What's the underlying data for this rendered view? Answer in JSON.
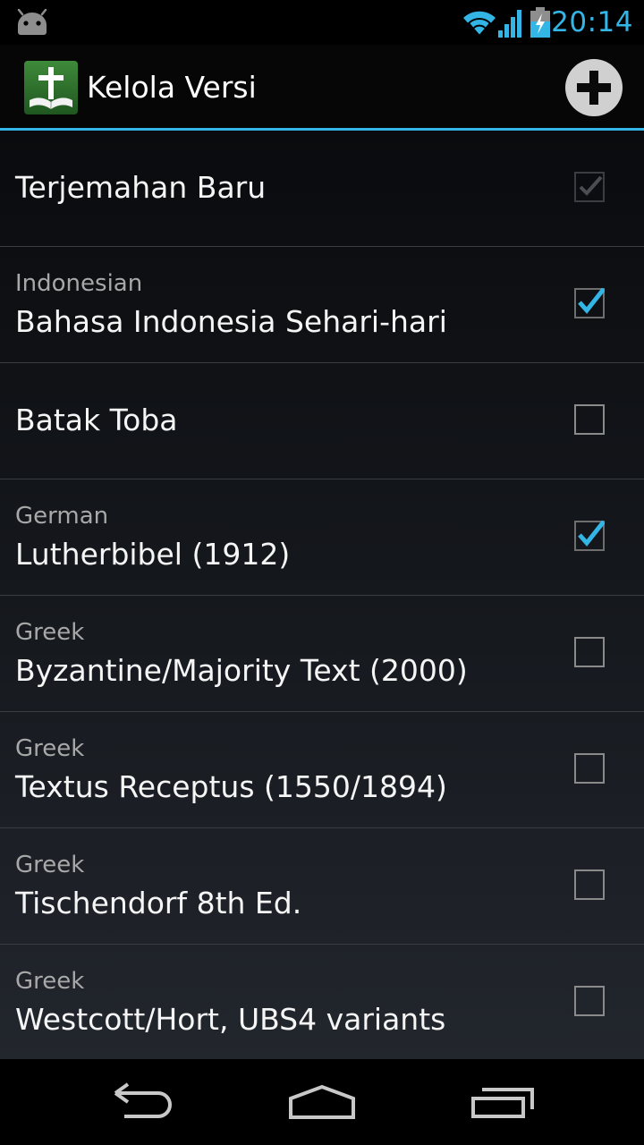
{
  "status_bar": {
    "time": "20:14",
    "accent_color": "#33b5e5",
    "icons": [
      "android-icon",
      "wifi-icon",
      "signal-icon",
      "battery-charging-icon"
    ]
  },
  "action_bar": {
    "title": "Kelola Versi",
    "app_icon": "bible-cross-icon",
    "action_icon": "add-icon"
  },
  "versions": [
    {
      "subtitle": "",
      "label": "Terjemahan Baru",
      "checked": true,
      "enabled": false
    },
    {
      "subtitle": "Indonesian",
      "label": "Bahasa Indonesia Sehari-hari",
      "checked": true,
      "enabled": true
    },
    {
      "subtitle": "",
      "label": "Batak Toba",
      "checked": false,
      "enabled": true
    },
    {
      "subtitle": "German",
      "label": "Lutherbibel (1912)",
      "checked": true,
      "enabled": true
    },
    {
      "subtitle": "Greek",
      "label": "Byzantine/Majority Text (2000)",
      "checked": false,
      "enabled": true
    },
    {
      "subtitle": "Greek",
      "label": "Textus Receptus (1550/1894)",
      "checked": false,
      "enabled": true
    },
    {
      "subtitle": "Greek",
      "label": "Tischendorf 8th Ed.",
      "checked": false,
      "enabled": true
    },
    {
      "subtitle": "Greek",
      "label": "Westcott/Hort, UBS4 variants",
      "checked": false,
      "enabled": true
    }
  ],
  "nav_bar": {
    "buttons": [
      "back-icon",
      "home-icon",
      "recent-apps-icon"
    ]
  }
}
